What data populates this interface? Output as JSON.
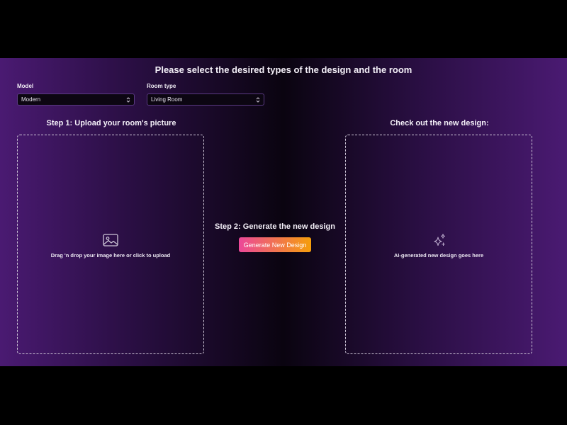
{
  "header": {
    "title": "Please select the desired types of the design and the room"
  },
  "model_select": {
    "label": "Model",
    "value": "Modern"
  },
  "room_select": {
    "label": "Room type",
    "value": "Living Room"
  },
  "step1": {
    "heading": "Step 1: Upload your room's picture",
    "dropzone_text": "Drag 'n drop your image here or click to upload",
    "icon": "image-icon"
  },
  "step2": {
    "heading": "Step 2: Generate the new design",
    "button_label": "Generate New Design",
    "button_colors": [
      "#ec4899",
      "#f59e0b"
    ]
  },
  "result": {
    "heading": "Check out the new design:",
    "placeholder_text": "AI-generated new design goes here",
    "icon": "sparkles-icon"
  },
  "colors": {
    "background_accent": "#4a1a72",
    "background_center": "#0a0410"
  }
}
